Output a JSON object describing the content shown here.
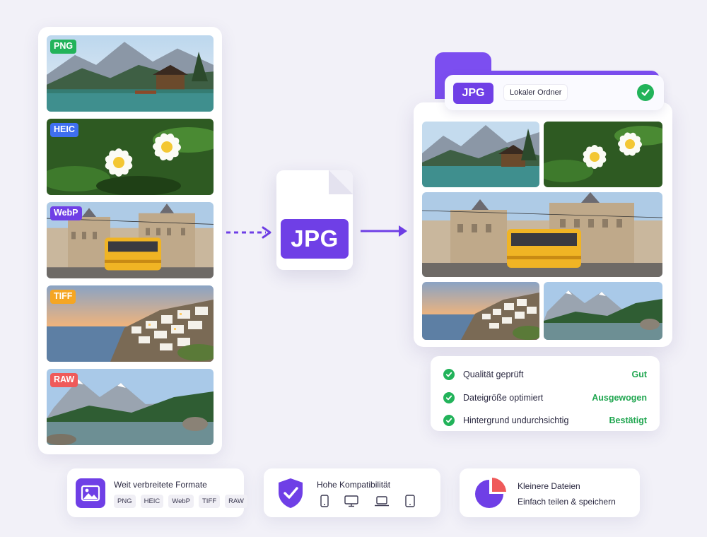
{
  "sources": [
    {
      "format": "PNG",
      "color": "#22b35a",
      "scene": "lake-cabin"
    },
    {
      "format": "HEIC",
      "color": "#3f6ff0",
      "scene": "plumeria-flowers"
    },
    {
      "format": "WebP",
      "color": "#6f3fe6",
      "scene": "city-tram"
    },
    {
      "format": "TIFF",
      "color": "#f5a623",
      "scene": "coastal-village-sunset"
    },
    {
      "format": "RAW",
      "color": "#ef5a5a",
      "scene": "mountain-lake"
    }
  ],
  "converter": {
    "label": "JPG"
  },
  "folder": {
    "format": "JPG",
    "name": "Lokaler Ordner"
  },
  "checks": [
    {
      "label": "Qualität geprüft",
      "value": "Gut"
    },
    {
      "label": "Dateigröße optimiert",
      "value": "Ausgewogen"
    },
    {
      "label": "Hintergrund undurchsichtig",
      "value": "Bestätigt"
    }
  ],
  "features": [
    {
      "title": "Weit verbreitete Formate",
      "icon": "image-icon",
      "chips": [
        "PNG",
        "HEIC",
        "WebP",
        "TIFF",
        "RAW"
      ]
    },
    {
      "title": "Hohe Kompatibilität",
      "icon": "shield-check-icon",
      "devices": [
        "smartphone-icon",
        "monitor-icon",
        "laptop-icon",
        "tablet-icon"
      ]
    },
    {
      "title": "Kleinere Dateien",
      "subtitle": "Einfach teilen & speichern",
      "icon": "pie-chart-icon"
    }
  ],
  "colors": {
    "accent": "#6f3fe6",
    "success": "#22b35a",
    "background": "#f2f1f8"
  }
}
